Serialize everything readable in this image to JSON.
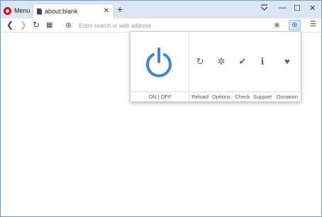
{
  "titlebar": {
    "menu_label": "Menu",
    "tab_title": "about:blank",
    "tab_close": "✕",
    "new_tab": "+",
    "tabs_menu": "⋮",
    "minimize": "—",
    "maximize": "☐",
    "close": "✕"
  },
  "addressbar": {
    "back": "❮",
    "forward": "❯",
    "reload": "↻",
    "speeddial": "▦",
    "globe": "⊕",
    "placeholder": "Enter search or web address",
    "camera": "◉",
    "extension": "⊕",
    "settings": "☰"
  },
  "popup": {
    "onoff_label": "ON | OFF",
    "actions": [
      {
        "label": "Reload",
        "icon": "↻",
        "icon_name": "reload-icon"
      },
      {
        "label": "Options",
        "icon": "✲",
        "icon_name": "gear-icon"
      },
      {
        "label": "Check",
        "icon": "✔",
        "icon_name": "check-icon"
      },
      {
        "label": "Support",
        "icon": "ℹ",
        "icon_name": "info-icon"
      },
      {
        "label": "Donation",
        "icon": "♥",
        "icon_name": "heart-icon"
      }
    ],
    "power_color": "#3d85d8"
  }
}
